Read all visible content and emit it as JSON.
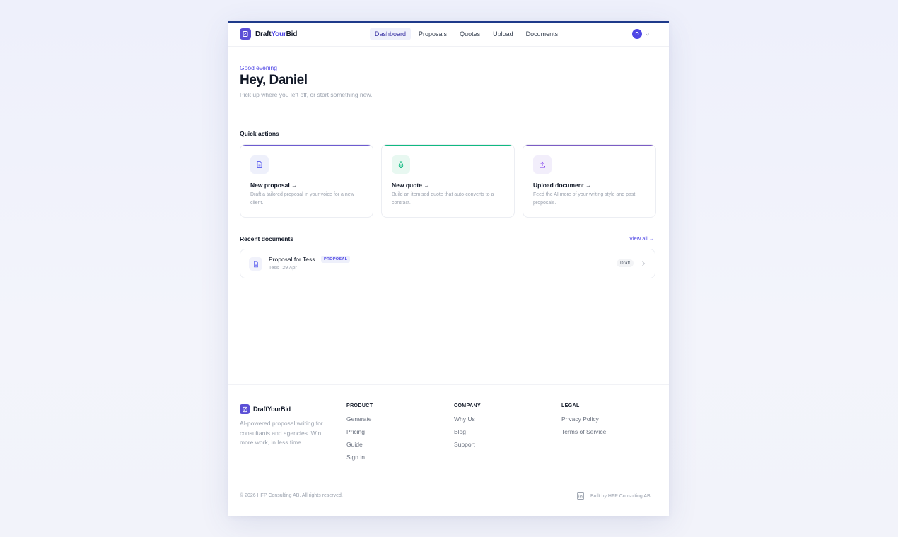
{
  "brand": {
    "name_part1": "Draft",
    "name_part2": "Your",
    "name_part3": "Bid",
    "footer_name": "DraftYourBid",
    "accent": "#4f46e5"
  },
  "nav": {
    "items": [
      {
        "label": "Dashboard",
        "active": true
      },
      {
        "label": "Proposals"
      },
      {
        "label": "Quotes"
      },
      {
        "label": "Upload"
      },
      {
        "label": "Documents"
      }
    ],
    "avatar_initial": "D"
  },
  "greeting": {
    "small": "Good evening",
    "title": "Hey, Daniel",
    "subtitle": "Pick up where you left off, or start something new."
  },
  "quick_actions": {
    "title": "Quick actions",
    "cards": [
      {
        "title": "New proposal →",
        "desc": "Draft a tailored proposal in your voice for a new client.",
        "icon": "document-icon",
        "color": "#6d5bd0"
      },
      {
        "title": "New quote →",
        "desc": "Build an itemised quote that auto-converts to a contract.",
        "icon": "money-bag-icon",
        "color": "#10b981"
      },
      {
        "title": "Upload document →",
        "desc": "Feed the AI more of your writing style and past proposals.",
        "icon": "upload-icon",
        "color": "#7c5cc4"
      }
    ]
  },
  "recent": {
    "title": "Recent documents",
    "view_all": "View all →",
    "items": [
      {
        "title": "Proposal for Tess",
        "tag": "PROPOSAL",
        "client": "Tess",
        "date": "29 Apr",
        "status": "Draft"
      }
    ]
  },
  "footer": {
    "about": "AI-powered proposal writing for consultants and agencies. Win more work, in less time.",
    "columns": [
      {
        "heading": "PRODUCT",
        "links": [
          "Generate",
          "Pricing",
          "Guide",
          "Sign in"
        ]
      },
      {
        "heading": "COMPANY",
        "links": [
          "Why Us",
          "Blog",
          "Support"
        ]
      },
      {
        "heading": "LEGAL",
        "links": [
          "Privacy Policy",
          "Terms of Service"
        ]
      }
    ],
    "copyright": "© 2026 HFP Consulting AB. All rights reserved.",
    "built_by": "Built by HFP Consulting AB"
  }
}
